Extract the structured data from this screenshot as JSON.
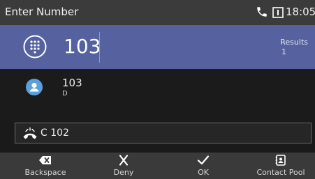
{
  "status_bar": {
    "title": "Enter Number",
    "time": "18:05"
  },
  "input": {
    "value": "103",
    "results_label": "Results",
    "results_count": "1"
  },
  "contacts": [
    {
      "name": "103",
      "detail": "D"
    }
  ],
  "active_call": {
    "label": "C 102"
  },
  "softkeys": [
    {
      "label": "Backspace",
      "icon": "backspace-icon"
    },
    {
      "label": "Deny",
      "icon": "close-icon"
    },
    {
      "label": "OK",
      "icon": "check-icon"
    },
    {
      "label": "Contact Pool",
      "icon": "contact-book-icon"
    }
  ],
  "colors": {
    "input_bar": "#56619f",
    "status_bar": "#3b3b3b",
    "softkey_bar": "#3a3a3a",
    "avatar": "#5aa0dc"
  }
}
